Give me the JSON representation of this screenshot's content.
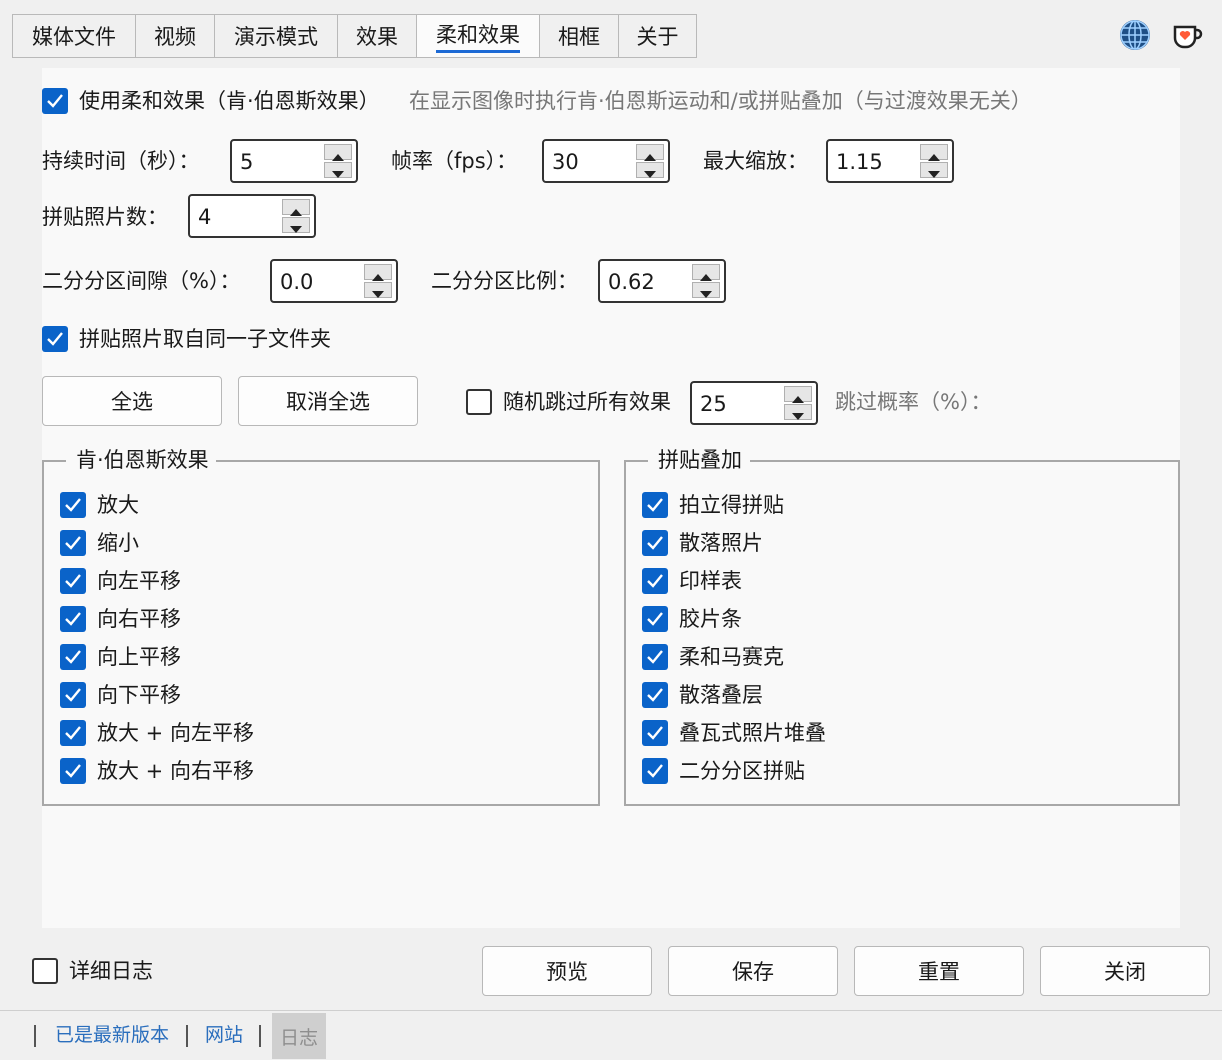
{
  "tabs": [
    {
      "label": "媒体文件",
      "active": false
    },
    {
      "label": "视频",
      "active": false
    },
    {
      "label": "演示模式",
      "active": false
    },
    {
      "label": "效果",
      "active": false
    },
    {
      "label": "柔和效果",
      "active": true
    },
    {
      "label": "相框",
      "active": false
    },
    {
      "label": "关于",
      "active": false
    }
  ],
  "icons": {
    "globe": "globe-icon",
    "cup": "coffee-cup-heart-icon"
  },
  "use_soft": {
    "checked": true,
    "label": "使用柔和效果（肯·伯恩斯效果）",
    "hint": "在显示图像时执行肯·伯恩斯运动和/或拼贴叠加（与过渡效果无关）"
  },
  "fields": {
    "duration": {
      "label": "持续时间（秒）：",
      "value": "5"
    },
    "fps": {
      "label": "帧率（fps）：",
      "value": "30"
    },
    "max_zoom": {
      "label": "最大缩放：",
      "value": "1.15"
    },
    "collage_count": {
      "label": "拼贴照片数：",
      "value": "4"
    },
    "split_gap": {
      "label": "二分分区间隙（%）：",
      "value": "0.0"
    },
    "split_ratio": {
      "label": "二分分区比例：",
      "value": "0.62"
    },
    "skip_prob": {
      "label": "跳过概率（%）：",
      "value": "25"
    }
  },
  "same_folder": {
    "checked": true,
    "label": "拼贴照片取自同一子文件夹"
  },
  "buttons": {
    "select_all": "全选",
    "deselect_all": "取消全选",
    "preview": "预览",
    "save": "保存",
    "reset": "重置",
    "close": "关闭"
  },
  "random_skip": {
    "checked": false,
    "label": "随机跳过所有效果"
  },
  "ken_burns": {
    "title": "肯·伯恩斯效果",
    "items": [
      {
        "label": "放大",
        "checked": true
      },
      {
        "label": "缩小",
        "checked": true
      },
      {
        "label": "向左平移",
        "checked": true
      },
      {
        "label": "向右平移",
        "checked": true
      },
      {
        "label": "向上平移",
        "checked": true
      },
      {
        "label": "向下平移",
        "checked": true
      },
      {
        "label": "放大 + 向左平移",
        "checked": true
      },
      {
        "label": "放大 + 向右平移",
        "checked": true
      }
    ]
  },
  "collage": {
    "title": "拼贴叠加",
    "items": [
      {
        "label": "拍立得拼贴",
        "checked": true
      },
      {
        "label": "散落照片",
        "checked": true
      },
      {
        "label": "印样表",
        "checked": true
      },
      {
        "label": "胶片条",
        "checked": true
      },
      {
        "label": "柔和马赛克",
        "checked": true
      },
      {
        "label": "散落叠层",
        "checked": true
      },
      {
        "label": "叠瓦式照片堆叠",
        "checked": true
      },
      {
        "label": "二分分区拼贴",
        "checked": true
      }
    ]
  },
  "verbose_log": {
    "checked": false,
    "label": "详细日志"
  },
  "status": {
    "latest": "已是最新版本",
    "website": "网站",
    "log": "日志"
  },
  "colors": {
    "accent": "#0a63c9",
    "link": "#2a6ebd"
  }
}
